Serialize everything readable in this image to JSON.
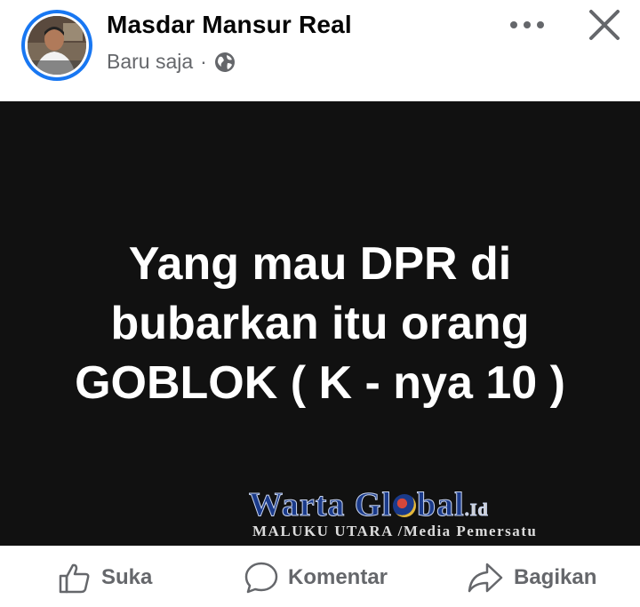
{
  "header": {
    "author": "Masdar Mansur Real",
    "timestamp": "Baru saja",
    "separator": "·",
    "privacy_icon": "globe-icon",
    "more_icon": "more-horizontal-icon",
    "close_icon": "close-icon"
  },
  "post": {
    "background": "#111111",
    "text_lines": [
      "Yang mau DPR di",
      "bubarkan itu orang",
      "GOBLOK ( K - nya 10 )"
    ],
    "watermark": {
      "title_part1": "Warta Gl",
      "title_part2": "bal",
      "tld": ".Id",
      "subtitle": "MALUKU UTARA  /Media Pemersatu"
    }
  },
  "actions": [
    {
      "label": "Suka",
      "icon": "thumbs-up-icon"
    },
    {
      "label": "Komentar",
      "icon": "comment-icon"
    },
    {
      "label": "Bagikan",
      "icon": "share-icon"
    }
  ],
  "colors": {
    "accent": "#1877f2",
    "text_primary": "#050505",
    "text_secondary": "#65676b"
  }
}
